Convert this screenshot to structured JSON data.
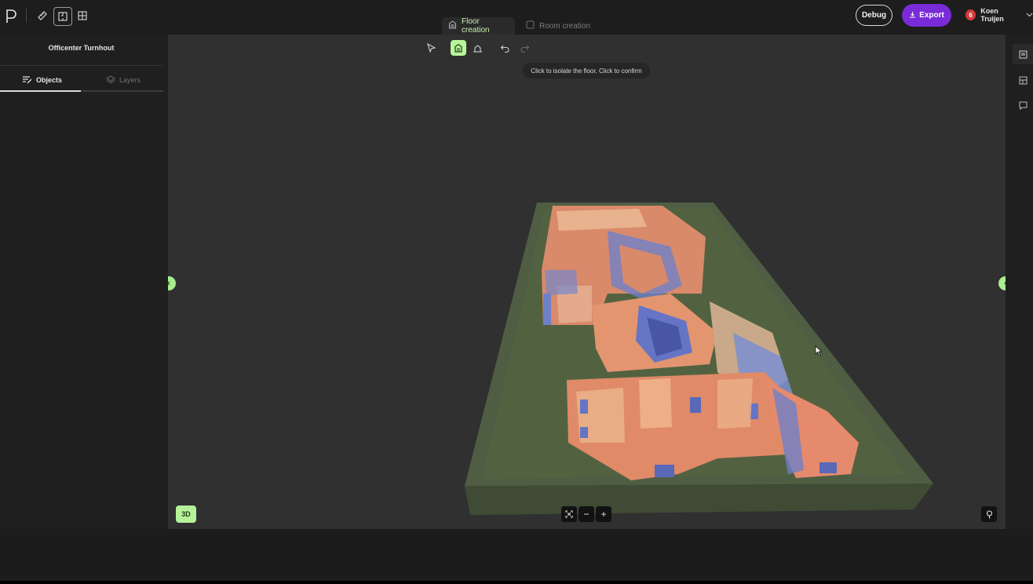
{
  "app": {
    "logo_icon": "p-logo-icon",
    "tools": [
      {
        "name": "ruler-icon"
      },
      {
        "name": "floorplan-icon",
        "active": true
      },
      {
        "name": "grid-icon"
      }
    ]
  },
  "mode_tabs": [
    {
      "label": "Floor creation",
      "icon": "building-icon",
      "active": true
    },
    {
      "label": "Room creation",
      "icon": "square-icon",
      "active": false
    }
  ],
  "header": {
    "debug_label": "Debug",
    "export_label": "Export",
    "user_name": "Koen Truijen",
    "user_badge": "6"
  },
  "sidebar": {
    "project_title": "Officenter Turnhout",
    "tabs": [
      {
        "label": "Objects",
        "icon": "list-edit-icon",
        "active": true
      },
      {
        "label": "Layers",
        "icon": "layers-icon",
        "active": false
      }
    ]
  },
  "viewport": {
    "tooltip": "Click to isolate the floor. Click to confirm",
    "view_mode": "3D",
    "toolbar": [
      {
        "name": "select-icon",
        "state": "normal"
      },
      {
        "name": "floor-isolate-icon",
        "state": "active"
      },
      {
        "name": "eraser-icon",
        "state": "normal"
      },
      {
        "name": "undo-icon",
        "state": "normal"
      },
      {
        "name": "redo-icon",
        "state": "disabled"
      }
    ],
    "zoom_controls": [
      "fit-icon",
      "zoom-out-icon",
      "zoom-in-icon"
    ]
  },
  "right_rail": [
    "panel-icon",
    "layout-icon",
    "comment-icon"
  ],
  "colors": {
    "accent_green": "#b5f29a",
    "export_purple": "#7a2bd8",
    "floor_green": "#4d5c40",
    "scan_orange": "#e07a5f",
    "scan_blue": "#6f7fc8"
  }
}
